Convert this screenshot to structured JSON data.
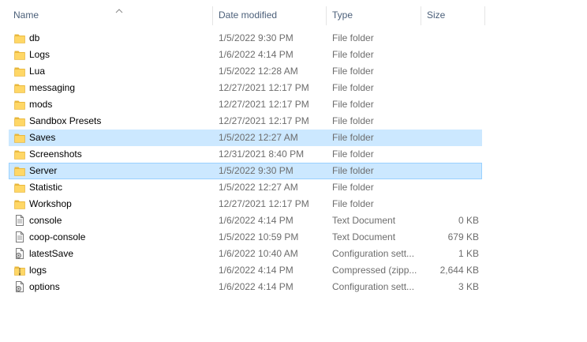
{
  "columns": {
    "name": "Name",
    "date": "Date modified",
    "type": "Type",
    "size": "Size"
  },
  "sort": {
    "column": "name",
    "direction": "ascending",
    "indicator": "chevron-up-icon"
  },
  "colors": {
    "selection": "#cce8ff",
    "selection_border": "#99d1ff",
    "folder": "#ffd766",
    "header_text": "#4c607a",
    "muted_text": "#6d6d6d"
  },
  "files": [
    {
      "name": "db",
      "date": "1/5/2022 9:30 PM",
      "type": "File folder",
      "size": "",
      "icon": "folder-icon"
    },
    {
      "name": "Logs",
      "date": "1/6/2022 4:14 PM",
      "type": "File folder",
      "size": "",
      "icon": "folder-icon"
    },
    {
      "name": "Lua",
      "date": "1/5/2022 12:28 AM",
      "type": "File folder",
      "size": "",
      "icon": "folder-icon"
    },
    {
      "name": "messaging",
      "date": "12/27/2021 12:17 PM",
      "type": "File folder",
      "size": "",
      "icon": "folder-icon"
    },
    {
      "name": "mods",
      "date": "12/27/2021 12:17 PM",
      "type": "File folder",
      "size": "",
      "icon": "folder-icon"
    },
    {
      "name": "Sandbox Presets",
      "date": "12/27/2021 12:17 PM",
      "type": "File folder",
      "size": "",
      "icon": "folder-icon"
    },
    {
      "name": "Saves",
      "date": "1/5/2022 12:27 AM",
      "type": "File folder",
      "size": "",
      "icon": "folder-icon",
      "state": "selected"
    },
    {
      "name": "Screenshots",
      "date": "12/31/2021 8:40 PM",
      "type": "File folder",
      "size": "",
      "icon": "folder-icon"
    },
    {
      "name": "Server",
      "date": "1/5/2022 9:30 PM",
      "type": "File folder",
      "size": "",
      "icon": "folder-icon",
      "state": "focused"
    },
    {
      "name": "Statistic",
      "date": "1/5/2022 12:27 AM",
      "type": "File folder",
      "size": "",
      "icon": "folder-icon"
    },
    {
      "name": "Workshop",
      "date": "12/27/2021 12:17 PM",
      "type": "File folder",
      "size": "",
      "icon": "folder-icon"
    },
    {
      "name": "console",
      "date": "1/6/2022 4:14 PM",
      "type": "Text Document",
      "size": "0 KB",
      "icon": "text-document-icon"
    },
    {
      "name": "coop-console",
      "date": "1/5/2022 10:59 PM",
      "type": "Text Document",
      "size": "679 KB",
      "icon": "text-document-icon"
    },
    {
      "name": "latestSave",
      "date": "1/6/2022 10:40 AM",
      "type": "Configuration sett...",
      "size": "1 KB",
      "icon": "config-file-icon"
    },
    {
      "name": "logs",
      "date": "1/6/2022 4:14 PM",
      "type": "Compressed (zipp...",
      "size": "2,644 KB",
      "icon": "zip-folder-icon"
    },
    {
      "name": "options",
      "date": "1/6/2022 4:14 PM",
      "type": "Configuration sett...",
      "size": "3 KB",
      "icon": "config-file-icon"
    }
  ]
}
